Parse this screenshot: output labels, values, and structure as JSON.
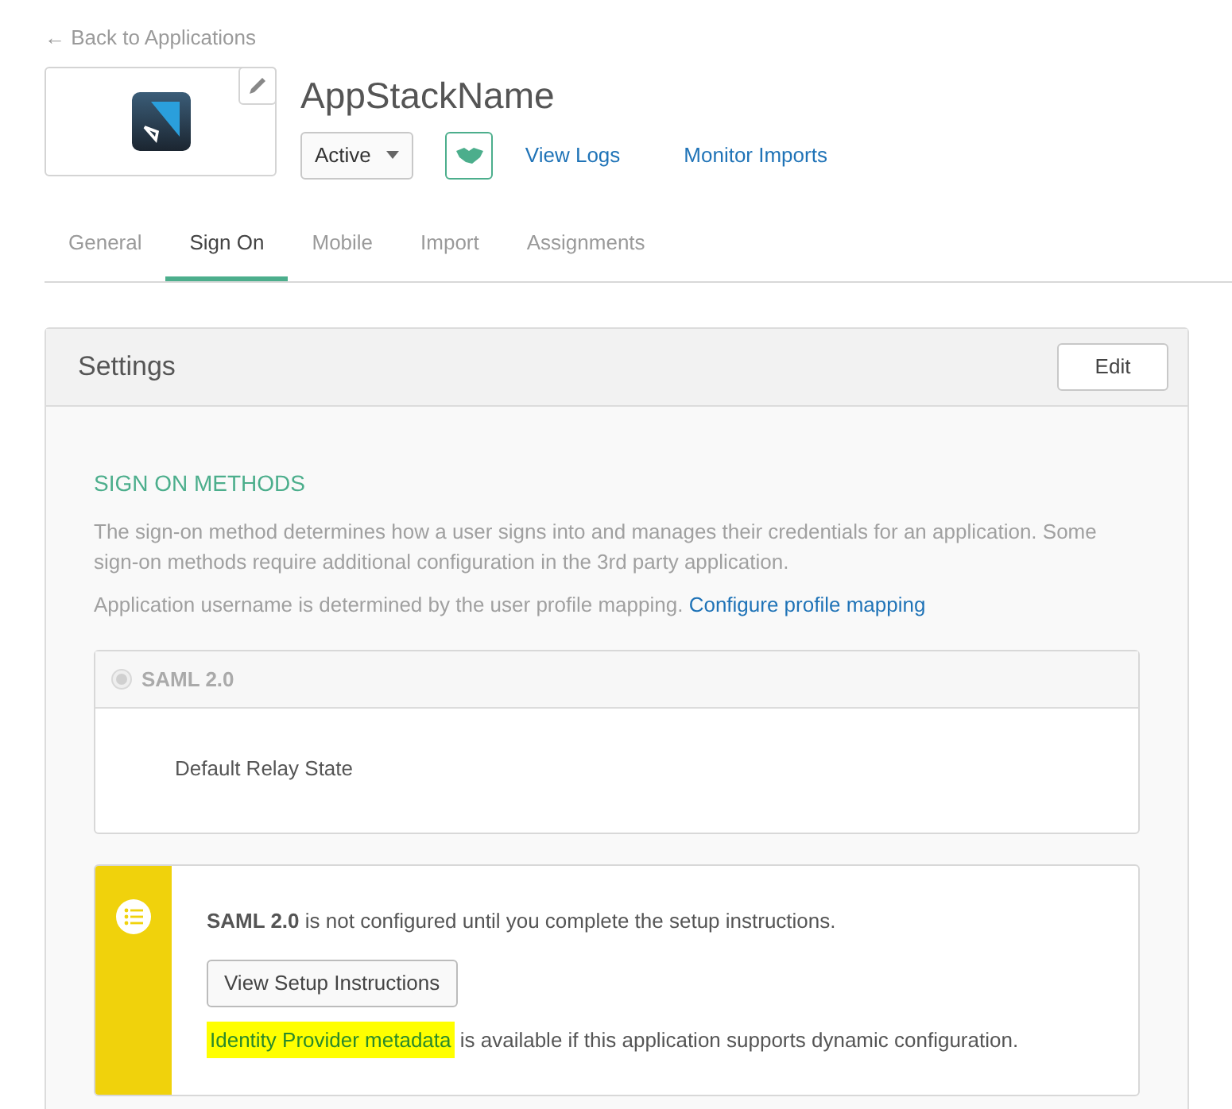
{
  "back_link": "← Back to Applications",
  "app": {
    "title": "AppStackName",
    "status": "Active",
    "links": [
      "View Logs",
      "Monitor Imports"
    ]
  },
  "tabs": [
    {
      "label": "General",
      "selected": false
    },
    {
      "label": "Sign On",
      "selected": true
    },
    {
      "label": "Mobile",
      "selected": false
    },
    {
      "label": "Import",
      "selected": false
    },
    {
      "label": "Assignments",
      "selected": false
    }
  ],
  "settings": {
    "title": "Settings",
    "edit_button": "Edit",
    "section_title": "SIGN ON METHODS",
    "description": "The sign-on method determines how a user signs into and manages their credentials for an application. Some sign-on methods require additional configuration in the 3rd party application.",
    "username_note": "Application username is determined by the user profile mapping.",
    "username_link": "Configure profile mapping",
    "method": {
      "label": "SAML 2.0",
      "selected": true,
      "disabled": true,
      "field_label": "Default Relay State"
    },
    "notice": {
      "message": "**SAML 2.0** is not configured until you complete the setup instructions.",
      "button": "View Setup Instructions",
      "link": "Identity Provider metadata",
      "link_highlighted": true,
      "rest": "is available if this application supports dynamic configuration."
    }
  }
}
